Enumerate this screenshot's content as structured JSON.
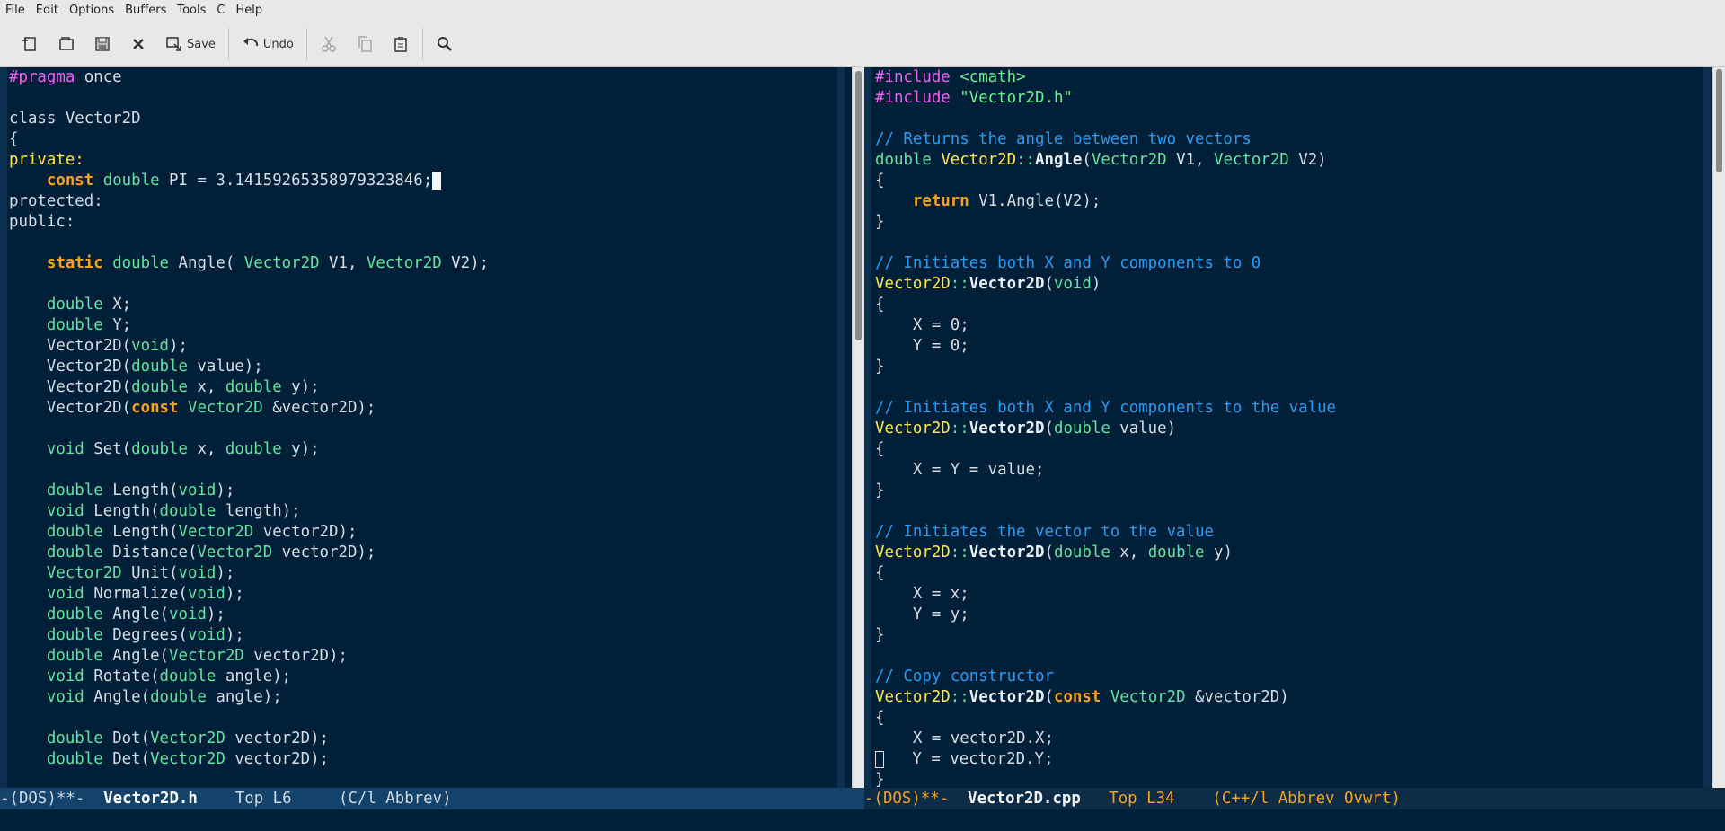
{
  "menubar": {
    "items": [
      "File",
      "Edit",
      "Options",
      "Buffers",
      "Tools",
      "C",
      "Help"
    ]
  },
  "toolbar": {
    "save_label": "Save",
    "undo_label": "Undo",
    "icons": [
      "new-file-icon",
      "open-folder-icon",
      "save-disk-icon",
      "close-x-icon",
      "save-icon",
      "undo-icon",
      "cut-icon",
      "copy-icon",
      "paste-icon",
      "search-icon"
    ]
  },
  "left_buffer": {
    "lines": {
      "l1a": "#pragma",
      "l1b": " once",
      "l3": "class Vector2D",
      "l4": "{",
      "l5": "private:",
      "l6a": "const",
      "l6b": "double",
      "l6c": " PI = 3.14159265358979323846;",
      "l7": "protected:",
      "l8": "public:",
      "l10a": "static",
      "l10b": "double",
      "l10c": " Angle( ",
      "l10d": "Vector2D",
      "l10e": " V1, ",
      "l10f": "Vector2D",
      "l10g": " V2);",
      "l12a": "double",
      "l12b": " X;",
      "l13a": "double",
      "l13b": " Y;",
      "l14a": "Vector2D(",
      "l14b": "void",
      "l14c": ");",
      "l15a": "Vector2D(",
      "l15b": "double",
      "l15c": " value);",
      "l16a": "Vector2D(",
      "l16b": "double",
      "l16c": " x, ",
      "l16d": "double",
      "l16e": " y);",
      "l17a": "Vector2D(",
      "l17b": "const",
      "l17c": "Vector2D",
      "l17d": " &vector2D);",
      "l19a": "void",
      "l19b": " Set(",
      "l19c": "double",
      "l19d": " x, ",
      "l19e": "double",
      "l19f": " y);",
      "l21a": "double",
      "l21b": " Length(",
      "l21c": "void",
      "l21d": ");",
      "l22a": "void",
      "l22b": " Length(",
      "l22c": "double",
      "l22d": " length);",
      "l23a": "double",
      "l23b": " Length(",
      "l23c": "Vector2D",
      "l23d": " vector2D);",
      "l24a": "double",
      "l24b": " Distance(",
      "l24c": "Vector2D",
      "l24d": " vector2D);",
      "l25a": "Vector2D",
      "l25b": " Unit(",
      "l25c": "void",
      "l25d": ");",
      "l26a": "void",
      "l26b": " Normalize(",
      "l26c": "void",
      "l26d": ");",
      "l27a": "double",
      "l27b": " Angle(",
      "l27c": "void",
      "l27d": ");",
      "l28a": "double",
      "l28b": " Degrees(",
      "l28c": "void",
      "l28d": ");",
      "l29a": "double",
      "l29b": " Angle(",
      "l29c": "Vector2D",
      "l29d": " vector2D);",
      "l30a": "void",
      "l30b": " Rotate(",
      "l30c": "double",
      "l30d": " angle);",
      "l31a": "void",
      "l31b": " Angle(",
      "l31c": "double",
      "l31d": " angle);",
      "l33a": "double",
      "l33b": " Dot(",
      "l33c": "Vector2D",
      "l33d": " vector2D);",
      "l34a": "double",
      "l34b": " Det(",
      "l34c": "Vector2D",
      "l34d": " vector2D);"
    }
  },
  "right_buffer": {
    "lines": {
      "r1a": "#include",
      "r1b": "<cmath>",
      "r2a": "#include",
      "r2b": "\"Vector2D.h\"",
      "r4": "// Returns the angle between two vectors",
      "r5a": "double",
      "r5b": "Vector2D",
      "r5c": "::",
      "r5d": "Angle",
      "r5e": "(",
      "r5f": "Vector2D",
      "r5g": " V1, ",
      "r5h": "Vector2D",
      "r5i": " V2)",
      "r6": "{",
      "r7a": "return",
      "r7b": " V1.Angle(V2);",
      "r8": "}",
      "r10": "// Initiates both X and Y components to 0",
      "r11a": "Vector2D",
      "r11b": "::",
      "r11c": "Vector2D",
      "r11d": "(",
      "r11e": "void",
      "r11f": ")",
      "r12": "{",
      "r13": "    X = 0;",
      "r14": "    Y = 0;",
      "r15": "}",
      "r17": "// Initiates both X and Y components to the value",
      "r18a": "Vector2D",
      "r18b": "::",
      "r18c": "Vector2D",
      "r18d": "(",
      "r18e": "double",
      "r18f": " value)",
      "r19": "{",
      "r20": "    X = Y = value;",
      "r21": "}",
      "r23": "// Initiates the vector to the value",
      "r24a": "Vector2D",
      "r24b": "::",
      "r24c": "Vector2D",
      "r24d": "(",
      "r24e": "double",
      "r24f": " x, ",
      "r24g": "double",
      "r24h": " y)",
      "r25": "{",
      "r26": "    X = x;",
      "r27": "    Y = y;",
      "r28": "}",
      "r30": "// Copy constructor",
      "r31a": "Vector2D",
      "r31b": "::",
      "r31c": "Vector2D",
      "r31d": "(",
      "r31e": "const",
      "r31f": "Vector2D",
      "r31g": " &vector2D)",
      "r32": "{",
      "r33": "    X = vector2D.X;",
      "r34": "   Y = vector2D.Y;",
      "r35": "}"
    }
  },
  "modeline_left": {
    "prefix": "-(DOS)**-  ",
    "buffer_name": "Vector2D.h",
    "position": "    Top L6     ",
    "mode": "(C/l Abbrev)"
  },
  "modeline_right": {
    "prefix": "-(DOS)**-  ",
    "buffer_name": "Vector2D.cpp",
    "position": "   Top L34    ",
    "mode": "(C++/l Abbrev Ovwrt)"
  },
  "colors": {
    "background": "#00203a",
    "keyword": "#f8a21e",
    "type": "#63e3a0",
    "preprocessor": "#f55ff1",
    "comment": "#2b9bef",
    "function_name": "#ffe84d",
    "string": "#6cf08f"
  }
}
